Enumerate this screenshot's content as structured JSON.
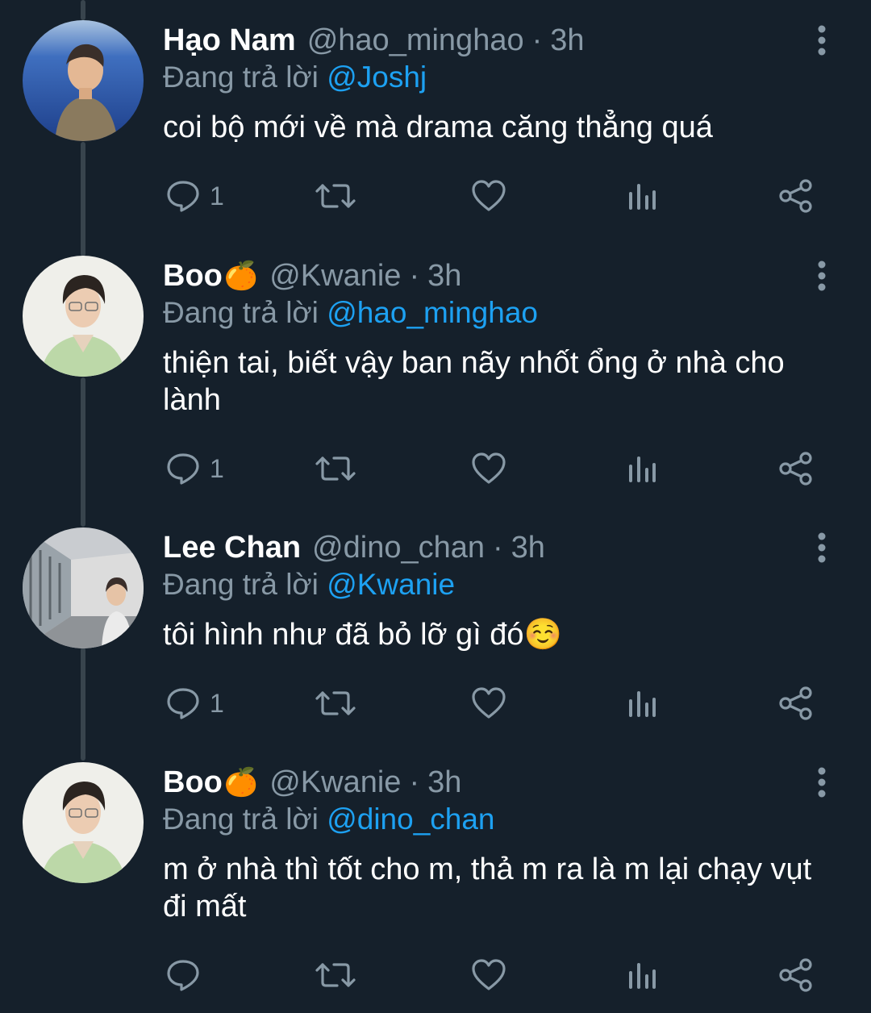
{
  "colors": {
    "background": "#15202b",
    "primary_text": "#ffffff",
    "secondary_text": "#8899a6",
    "link": "#1da1f2",
    "thread_line": "#38444d"
  },
  "replying_prefix": "Đang trả lời",
  "tweets": [
    {
      "name": "Hạo Nam",
      "name_emoji": "",
      "handle": "@hao_minghao",
      "separator": "·",
      "time": "3h",
      "replying_to": "@Joshj",
      "text": "coi bộ mới về mà drama căng thẳng quá",
      "reply_count": "1",
      "icons": [
        "reply-icon",
        "retweet-icon",
        "like-icon",
        "analytics-icon",
        "share-icon",
        "more-options-icon"
      ]
    },
    {
      "name": "Boo",
      "name_emoji": "🍊",
      "handle": "@Kwanie",
      "separator": "·",
      "time": "3h",
      "replying_to": "@hao_minghao",
      "text": "thiện tai, biết vậy ban nãy nhốt ổng ở nhà cho lành",
      "reply_count": "1"
    },
    {
      "name": "Lee Chan",
      "name_emoji": "",
      "handle": "@dino_chan",
      "separator": "·",
      "time": "3h",
      "replying_to": "@Kwanie",
      "text": "tôi hình như đã bỏ lỡ gì đó☺️",
      "reply_count": "1"
    },
    {
      "name": "Boo",
      "name_emoji": "🍊",
      "handle": "@Kwanie",
      "separator": "·",
      "time": "3h",
      "replying_to": "@dino_chan",
      "text": "m ở nhà thì tốt cho m, thả m ra là m lại chạy vụt đi mất",
      "reply_count": ""
    }
  ]
}
